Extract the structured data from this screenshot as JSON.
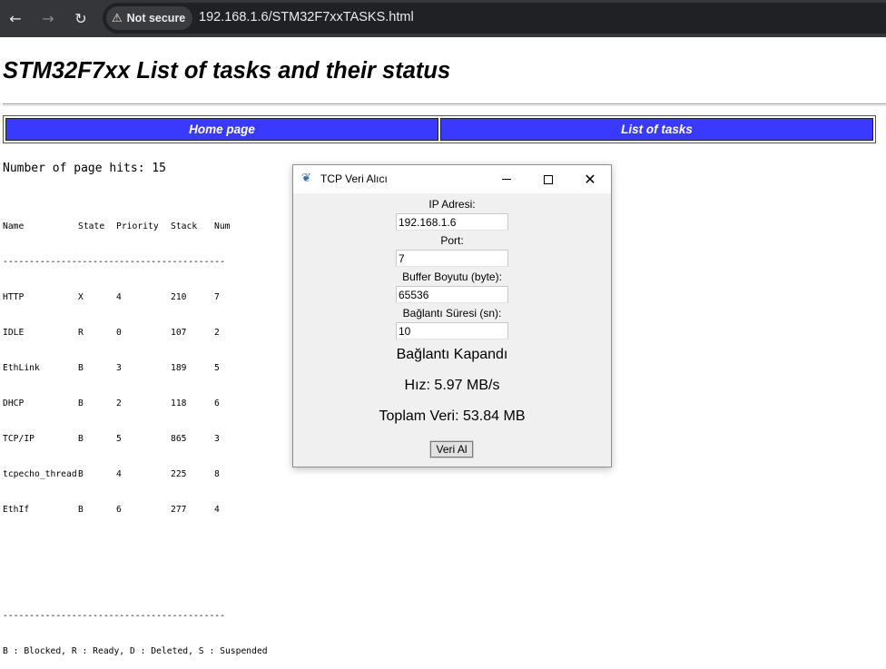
{
  "browser": {
    "security_label": "Not secure",
    "url": "192.168.1.6/STM32F7xxTASKS.html"
  },
  "page": {
    "title": "STM32F7xx List of tasks and their status",
    "nav": [
      "Home page",
      "List of tasks"
    ],
    "hits_text": "Number of page hits: 15",
    "table": {
      "headers": [
        "Name",
        "State",
        "Priority",
        "Stack",
        "Num"
      ],
      "separator": "------------------------------------------",
      "rows": [
        [
          "HTTP",
          "X",
          "4",
          "210",
          "7"
        ],
        [
          "IDLE",
          "R",
          "0",
          "107",
          "2"
        ],
        [
          "EthLink",
          "B",
          "3",
          "189",
          "5"
        ],
        [
          "DHCP",
          "B",
          "2",
          "118",
          "6"
        ],
        [
          "TCP/IP",
          "B",
          "5",
          "865",
          "3"
        ],
        [
          "tcpecho_thread",
          "B",
          "4",
          "225",
          "8"
        ],
        [
          "EthIf",
          "B",
          "6",
          "277",
          "4"
        ]
      ],
      "legend": "B : Blocked, R : Ready, D : Deleted, S : Suspended"
    }
  },
  "dialog": {
    "title": "TCP Veri Alıcı",
    "ip_label": "IP Adresi:",
    "ip_value": "192.168.1.6",
    "port_label": "Port:",
    "port_value": "7",
    "buffer_label": "Buffer Boyutu (byte):",
    "buffer_value": "65536",
    "duration_label": "Bağlantı Süresi (sn):",
    "duration_value": "10",
    "status": "Bağlantı Kapandı",
    "speed": "Hız: 5.97 MB/s",
    "total": "Toplam Veri: 53.84 MB",
    "receive_button": "Veri Al"
  },
  "icons": {
    "back": "arrow-left-icon",
    "forward": "arrow-right-icon",
    "reload": "reload-icon",
    "warning": "warning-triangle-icon",
    "app": "feather-icon",
    "minimize": "minimize-icon",
    "maximize": "maximize-icon",
    "close": "close-icon"
  }
}
